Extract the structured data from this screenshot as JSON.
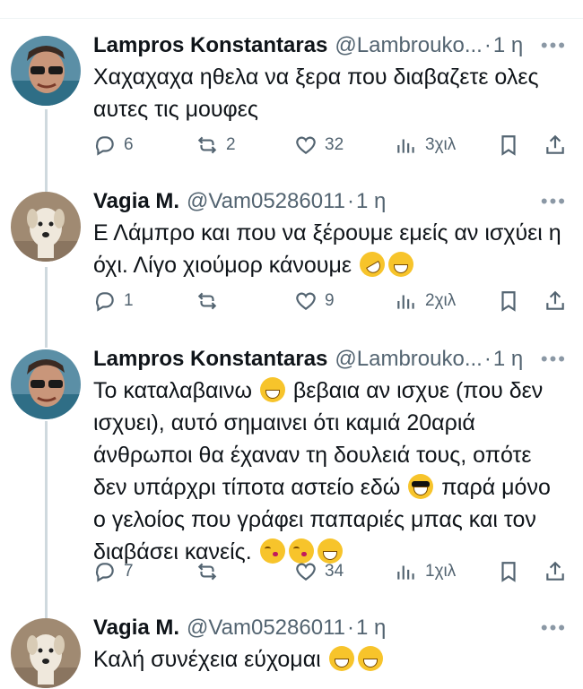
{
  "tweets": [
    {
      "name": "Lampros Konstantaras",
      "handle": "@Lambrouko...",
      "time": "1 η",
      "text_parts": [
        "Χαχαχαχα ηθελα να ξερα που διαβαζετε ολες αυτες τις μουφες"
      ],
      "replies": "6",
      "reposts": "2",
      "likes": "32",
      "views": "3χιλ"
    },
    {
      "name": "Vagia M.",
      "handle": "@Vam05286011",
      "time": "1 η",
      "text_parts": [
        "Ε Λάμπρο και που να ξέρουμε εμείς αν ισχύει η όχι. Λίγο χιούμορ κάνουμε"
      ],
      "replies": "1",
      "reposts": "",
      "likes": "9",
      "views": "2χιλ"
    },
    {
      "name": "Lampros Konstantaras",
      "handle": "@Lambrouko...",
      "time": "1 η",
      "text_parts": [
        "Το καταλαβαινω",
        "βεβαια αν ισχυε (που δεν ισχυει), αυτό σημαινει ότι καμιά 20αριά άνθρωποι θα έχαναν τη δουλειά τους, οπότε δεν υπάρχρι τίποτα αστείο εδώ",
        "παρά μόνο ο γελοίος που γράφει παπαριές μπας και τον διαβάσει κανείς."
      ],
      "replies": "7",
      "reposts": "",
      "likes": "34",
      "views": "1χιλ"
    },
    {
      "name": "Vagia M.",
      "handle": "@Vam05286011",
      "time": "1 η",
      "text_parts": [
        "Καλή συνέχεια εύχομαι"
      ]
    }
  ],
  "icons": [
    "reply-icon",
    "repost-icon",
    "like-icon",
    "views-icon",
    "bookmark-icon",
    "share-icon",
    "more-icon"
  ],
  "colors": {
    "text": "#0f1419",
    "secondary": "#536471",
    "thread_line": "#cfd9de"
  }
}
